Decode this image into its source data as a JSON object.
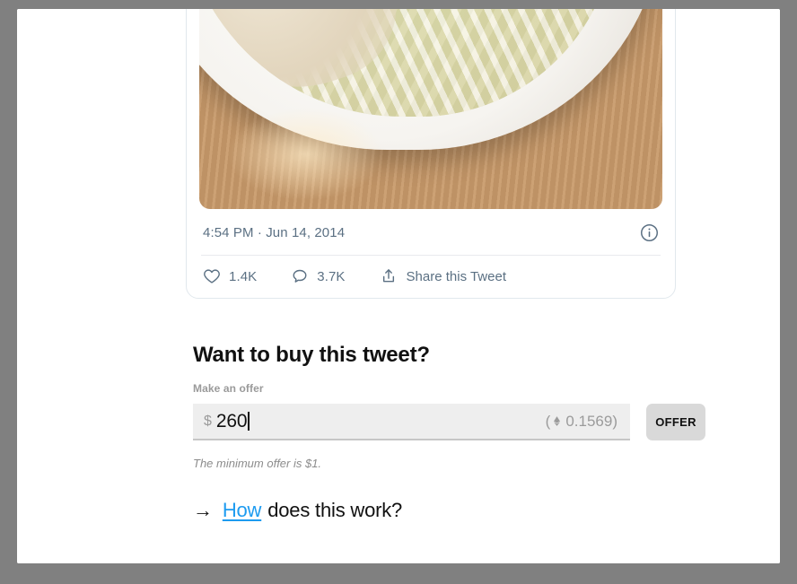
{
  "tweet": {
    "photo_alt": "bowl-of-bean-sprouts-cabbage-and-meat",
    "timestamp": "4:54 PM · Jun 14, 2014",
    "info_icon": "info-circle-icon",
    "actions": {
      "like_icon": "heart-icon",
      "like_count": "1.4K",
      "reply_icon": "reply-icon",
      "reply_count": "3.7K",
      "share_icon": "share-upload-icon",
      "share_label": "Share this Tweet"
    }
  },
  "buy": {
    "title": "Want to buy this tweet?",
    "offer_label": "Make an offer",
    "currency_symbol": "$",
    "amount": "260",
    "eth_open_paren": "(",
    "eth_icon": "ethereum-diamond-icon",
    "eth_amount": "0.1569",
    "eth_close_paren": ")",
    "offer_button_label": "OFFER",
    "min_offer_note": "The minimum offer is $1.",
    "how_arrow": "→",
    "how_link_text": "How",
    "how_rest_text": "does this work?"
  },
  "colors": {
    "link_blue": "#1d9bf0",
    "tweet_meta_slate": "#5b7083",
    "input_background": "#eeeeee",
    "button_background": "#d9d9d9",
    "frame_gray": "#808080"
  }
}
